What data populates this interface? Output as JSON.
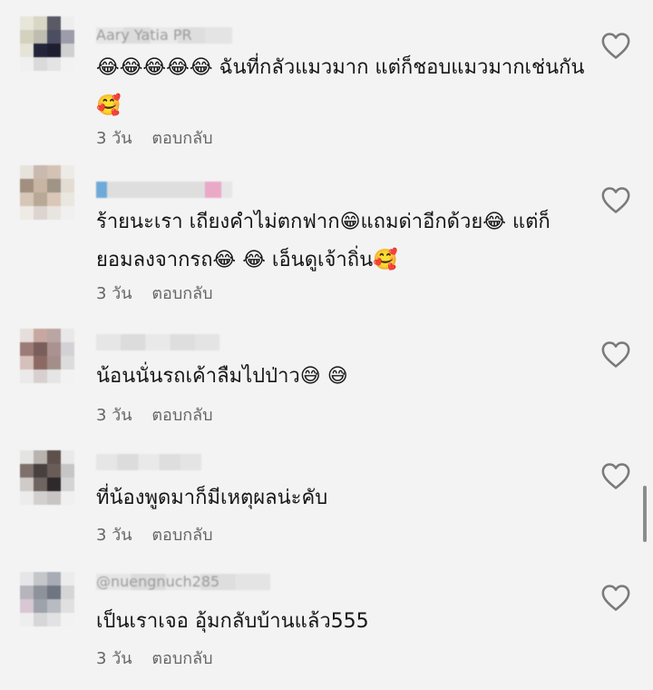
{
  "comments": [
    {
      "username": "Aary Yatia PR",
      "text": "😂😂😂😂😂 ฉันที่กลัวแมวมาก แต่ก็ชอบแมวมากเช่นกัน🥰",
      "time": "3 วัน",
      "reply": "ตอบกลับ"
    },
    {
      "username": "",
      "text": "ร้ายนะเรา เถียงคำไม่ตกฟาก😁แถมด่าอีกด้วย😂 แต่ก็ยอมลงจากรถ😂 😂 เอ็นดูเจ้าถิ่น🥰",
      "time": "3 วัน",
      "reply": "ตอบกลับ"
    },
    {
      "username": "",
      "text": "น้อนนั่นรถเค้าลืมไปป่าว😅 😅",
      "time": "3 วัน",
      "reply": "ตอบกลับ"
    },
    {
      "username": "",
      "text": "ที่น้องพูดมาก็มีเหตุผลน่ะคับ",
      "time": "3 วัน",
      "reply": "ตอบกลับ"
    },
    {
      "username": "@nuengnuch285",
      "text": "เป็นเราเจอ อุ้มกลับบ้านแล้ว555",
      "time": "3 วัน",
      "reply": "ตอบกลับ"
    }
  ],
  "icons": {
    "like": "heart-outline-icon"
  },
  "colors": {
    "background": "#f3f3f3",
    "meta": "#666666",
    "heart": "#7a7a7a"
  }
}
